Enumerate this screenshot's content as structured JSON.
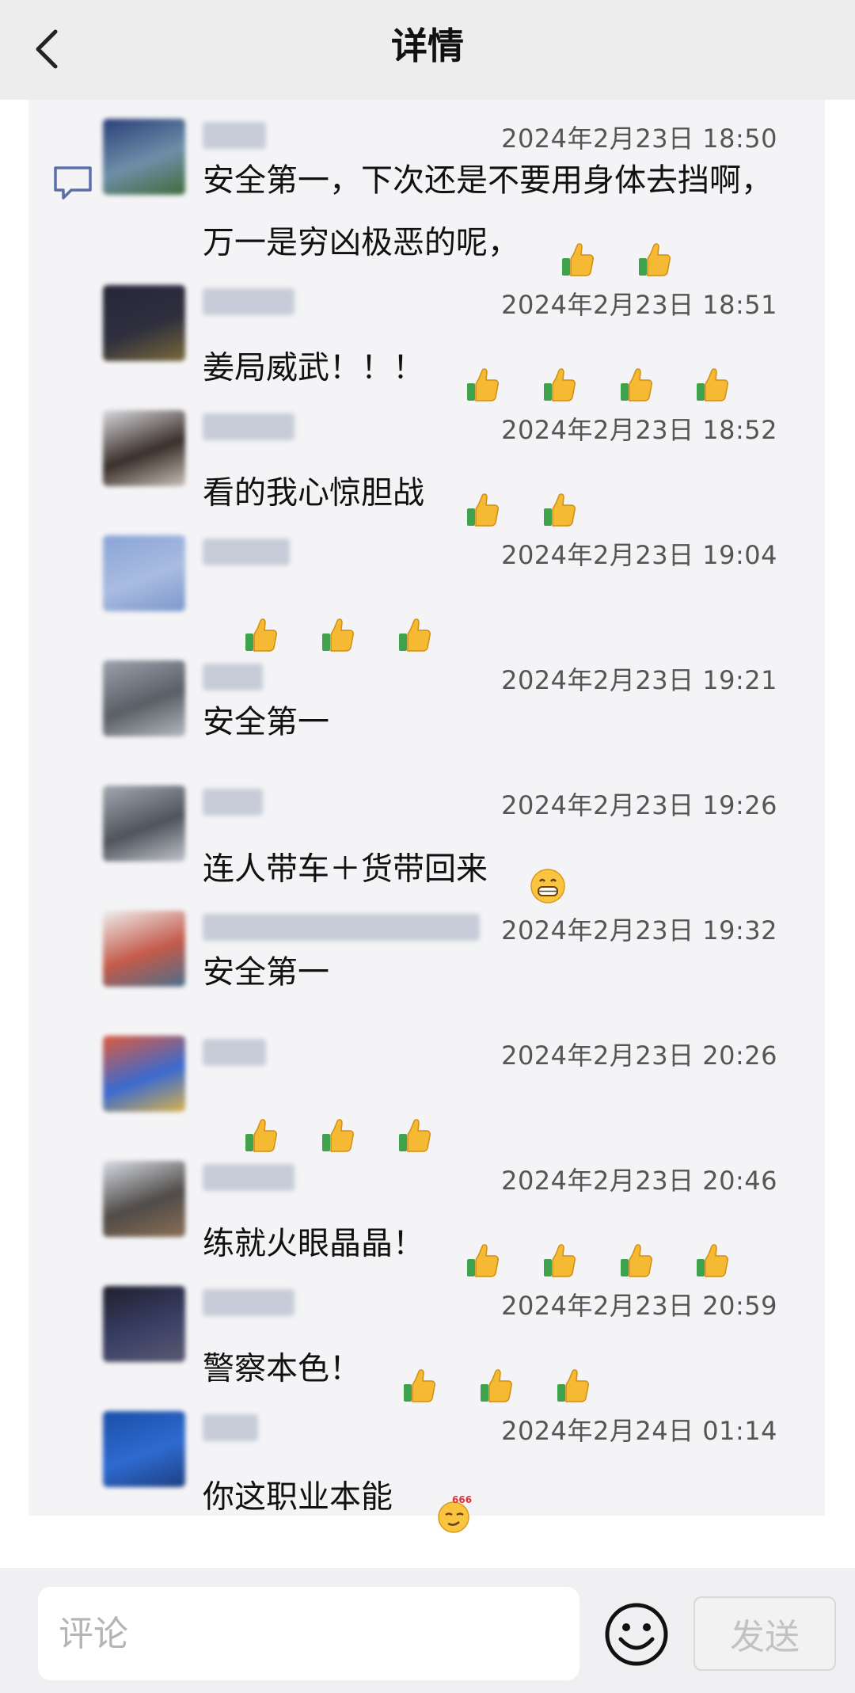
{
  "header": {
    "title": "详情"
  },
  "comments": [
    {
      "time": "2024年2月23日 18:50",
      "text": "安全第一，下次还是不要用身体去挡啊，万一是穷凶极恶的呢，",
      "emojis": [
        "thumbs-up",
        "thumbs-up"
      ],
      "name_len": 80,
      "colors": [
        "#2a3f7a",
        "#6e8fa8",
        "#3f6b3a"
      ]
    },
    {
      "time": "2024年2月23日 18:51",
      "text": "姜局威武！！！",
      "emojis": [
        "thumbs-up",
        "thumbs-up",
        "thumbs-up",
        "thumbs-up"
      ],
      "name_len": 116,
      "colors": [
        "#26263a",
        "#2f2f3e",
        "#7a6a3a"
      ]
    },
    {
      "time": "2024年2月23日 18:52",
      "text": "看的我心惊胆战",
      "emojis": [
        "thumbs-up",
        "thumbs-up"
      ],
      "name_len": 116,
      "colors": [
        "#d9d9de",
        "#3a2f2a",
        "#c9bfb8"
      ]
    },
    {
      "time": "2024年2月23日 19:04",
      "text": "",
      "emojis": [
        "thumbs-up",
        "thumbs-up",
        "thumbs-up"
      ],
      "name_len": 110,
      "colors": [
        "#8aa4d8",
        "#a9bce0",
        "#7d96cc"
      ]
    },
    {
      "time": "2024年2月23日 19:21",
      "text": "安全第一",
      "emojis": [],
      "name_len": 76,
      "colors": [
        "#9aa2ad",
        "#5a5f66",
        "#b3b8bf"
      ]
    },
    {
      "time": "2024年2月23日 19:26",
      "text": "连人带车＋货带回来",
      "emojis": [
        "grin"
      ],
      "name_len": 76,
      "colors": [
        "#a3a9b2",
        "#4f545c",
        "#c0c4ca"
      ]
    },
    {
      "time": "2024年2月23日 19:32",
      "text": "安全第一",
      "emojis": [],
      "name_len": 350,
      "colors": [
        "#eeeeee",
        "#c45a4a",
        "#4a6f8a"
      ]
    },
    {
      "time": "2024年2月23日 20:26",
      "text": "",
      "emojis": [
        "thumbs-up",
        "thumbs-up",
        "thumbs-up"
      ],
      "name_len": 80,
      "colors": [
        "#e05a3a",
        "#3a6ad0",
        "#d8b24a"
      ]
    },
    {
      "time": "2024年2月23日 20:46",
      "text": "练就火眼晶晶！",
      "emojis": [
        "thumbs-up",
        "thumbs-up",
        "thumbs-up",
        "thumbs-up"
      ],
      "name_len": 116,
      "colors": [
        "#d8dde5",
        "#4f4b48",
        "#8a6f55"
      ]
    },
    {
      "time": "2024年2月23日 20:59",
      "text": "警察本色！",
      "emojis": [
        "thumbs-up",
        "thumbs-up",
        "thumbs-up"
      ],
      "name_len": 116,
      "colors": [
        "#1f1f2c",
        "#3a3f66",
        "#5a5a70"
      ]
    },
    {
      "time": "2024年2月24日 01:14",
      "text": "你这职业本能",
      "emojis": [
        "666"
      ],
      "name_len": 70,
      "colors": [
        "#1a4fa8",
        "#2f6ad0",
        "#1b3f80"
      ]
    }
  ],
  "composer": {
    "placeholder": "评论",
    "send_label": "发送",
    "emoji_button_icon": "smiley-face-icon"
  }
}
